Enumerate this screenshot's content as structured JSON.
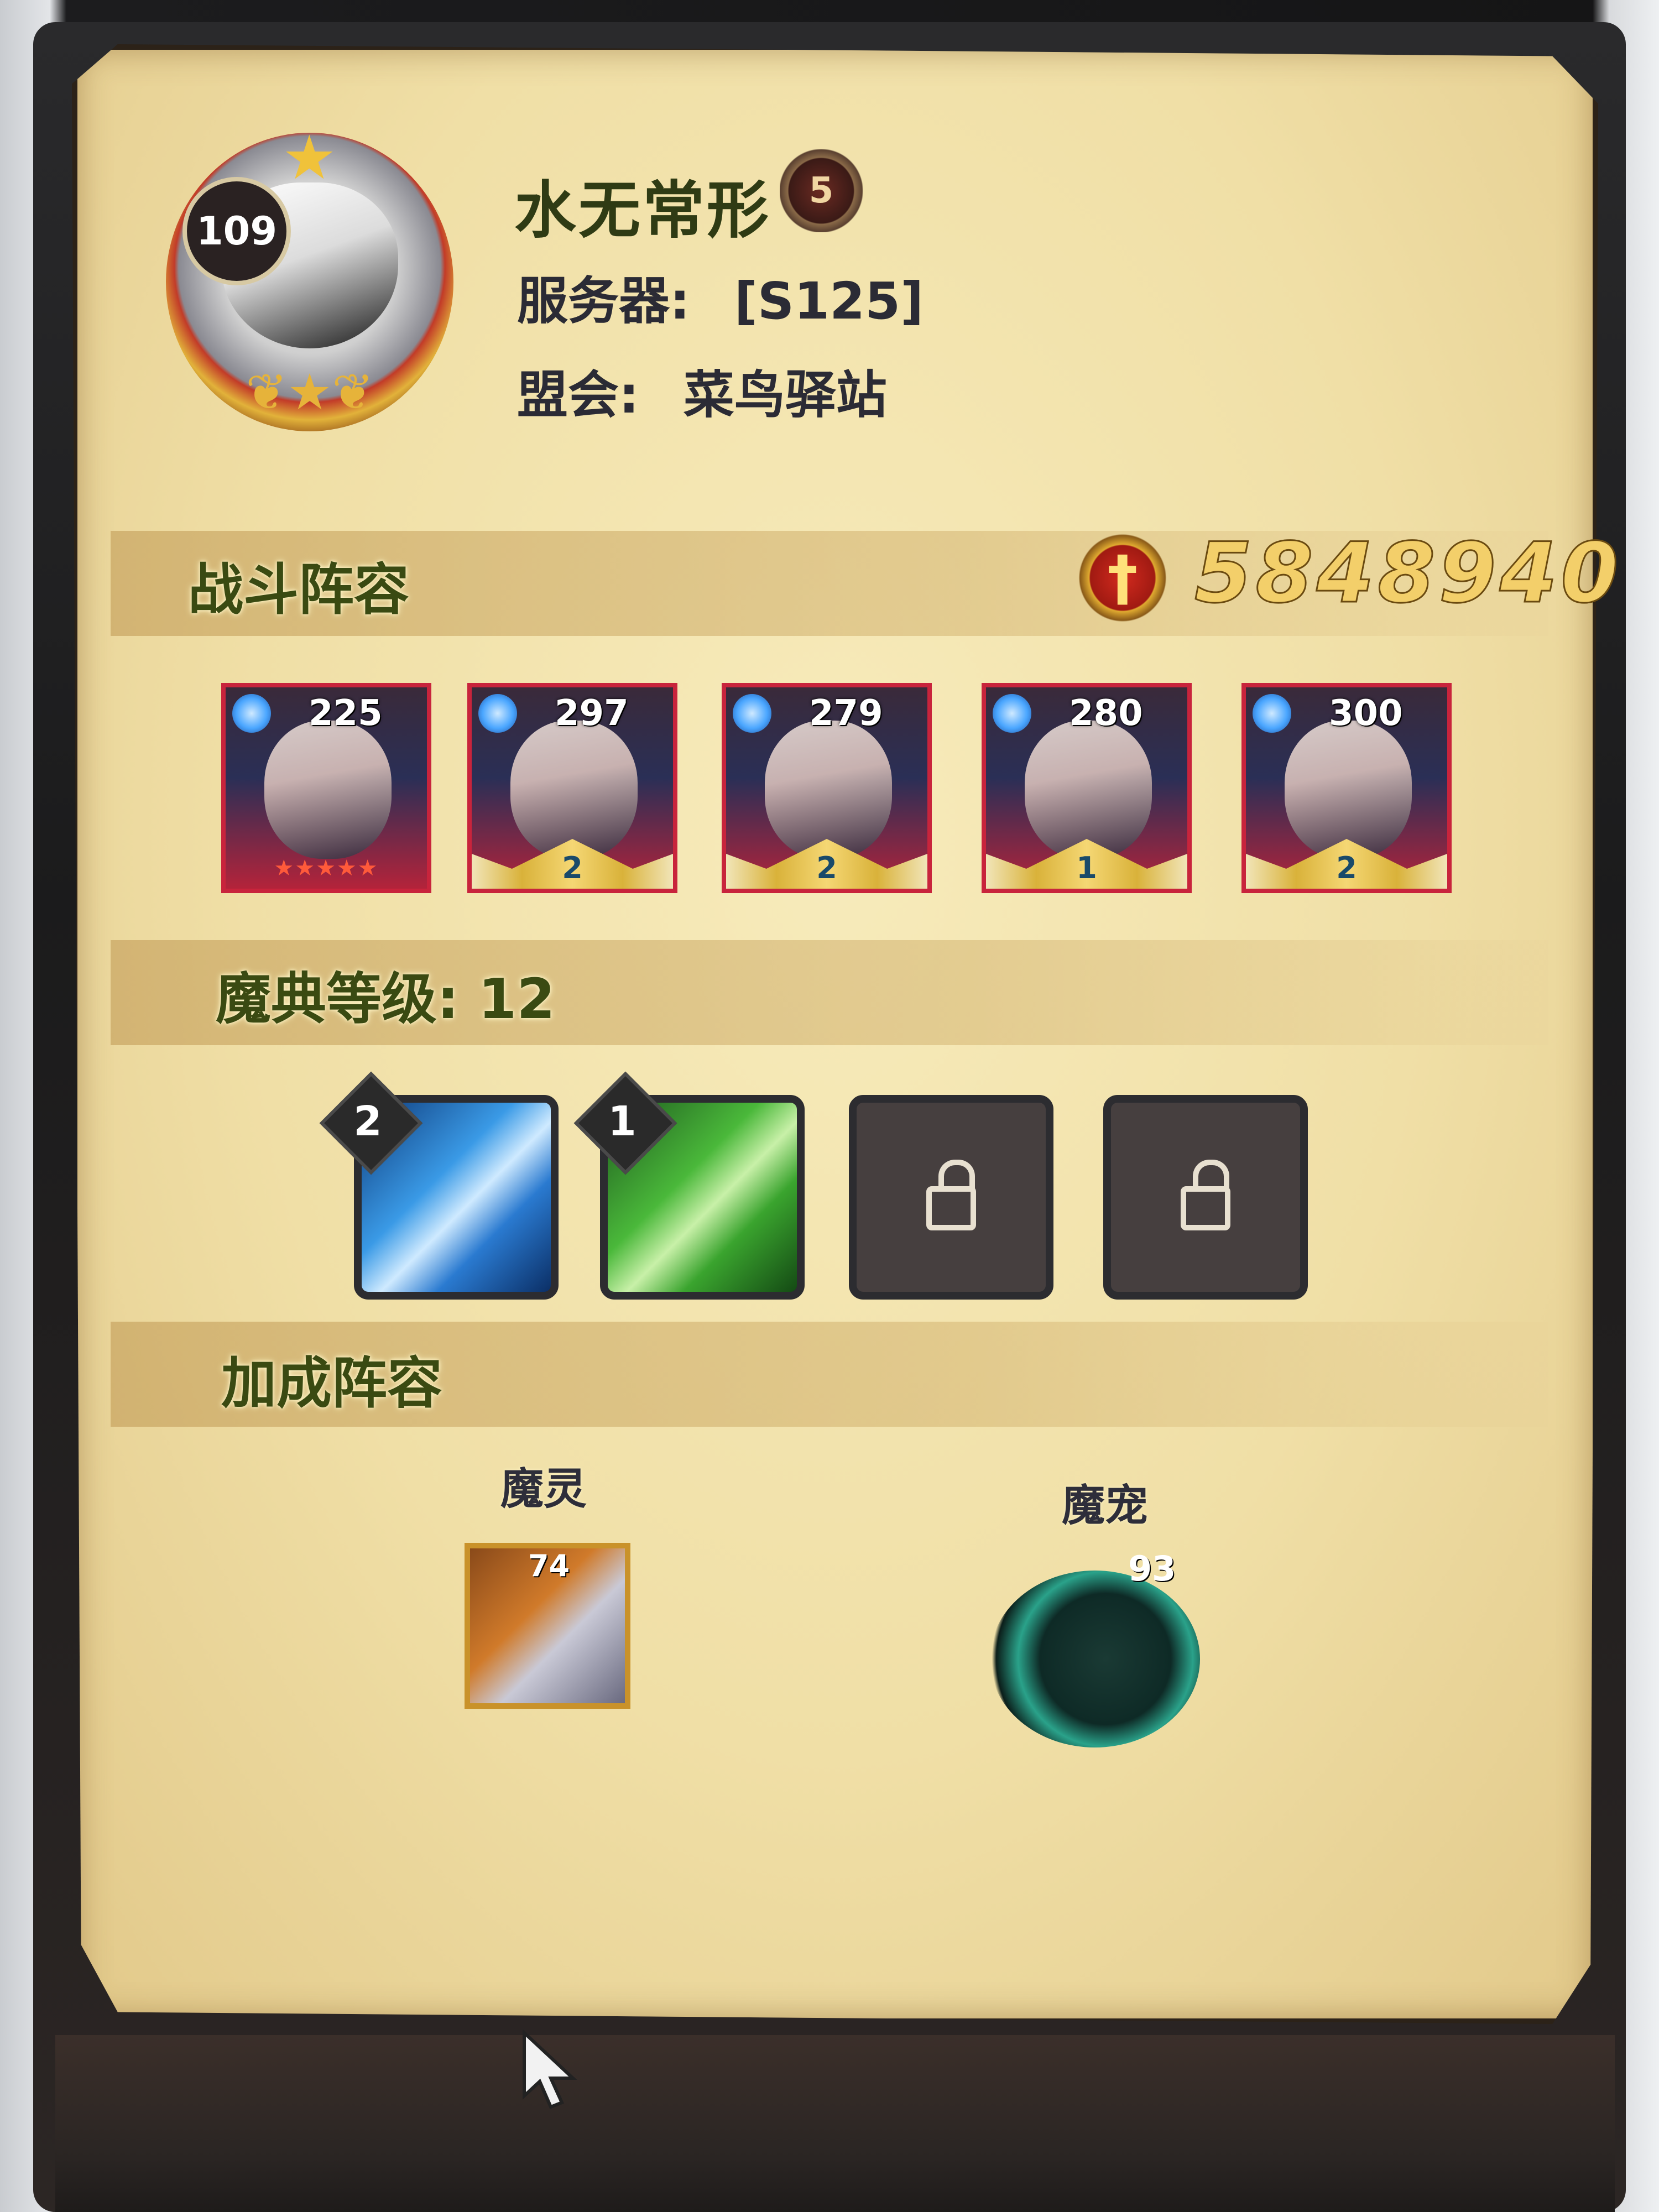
{
  "player": {
    "level": "109",
    "name": "水无常形",
    "rank_badge": "5",
    "server_label": "服务器:",
    "server_value": "[S125]",
    "guild_label": "盟会:",
    "guild_value": "菜鸟驿站"
  },
  "battle_lineup": {
    "title": "战斗阵容",
    "power": "5848940",
    "heroes": [
      {
        "level": "225",
        "star_badge": ""
      },
      {
        "level": "297",
        "star_badge": "2"
      },
      {
        "level": "279",
        "star_badge": "2"
      },
      {
        "level": "280",
        "star_badge": "1"
      },
      {
        "level": "300",
        "star_badge": "2"
      }
    ]
  },
  "grimoire": {
    "title": "魔典等级: 12",
    "slots": [
      {
        "badge": "2",
        "icon": "ice-shard-icon"
      },
      {
        "badge": "1",
        "icon": "healing-leaf-icon"
      },
      {
        "badge": "",
        "icon": "lock-icon"
      },
      {
        "badge": "",
        "icon": "lock-icon"
      }
    ]
  },
  "bonus_lineup": {
    "title": "加成阵容",
    "spirit_label": "魔灵",
    "spirit_level": "74",
    "pet_label": "魔宠",
    "pet_level": "93"
  },
  "colors": {
    "parchment": "#f0dfa6",
    "hero_frame": "#c8243c",
    "power_text": "#f3cf6a",
    "section_text": "#3a4a12"
  }
}
